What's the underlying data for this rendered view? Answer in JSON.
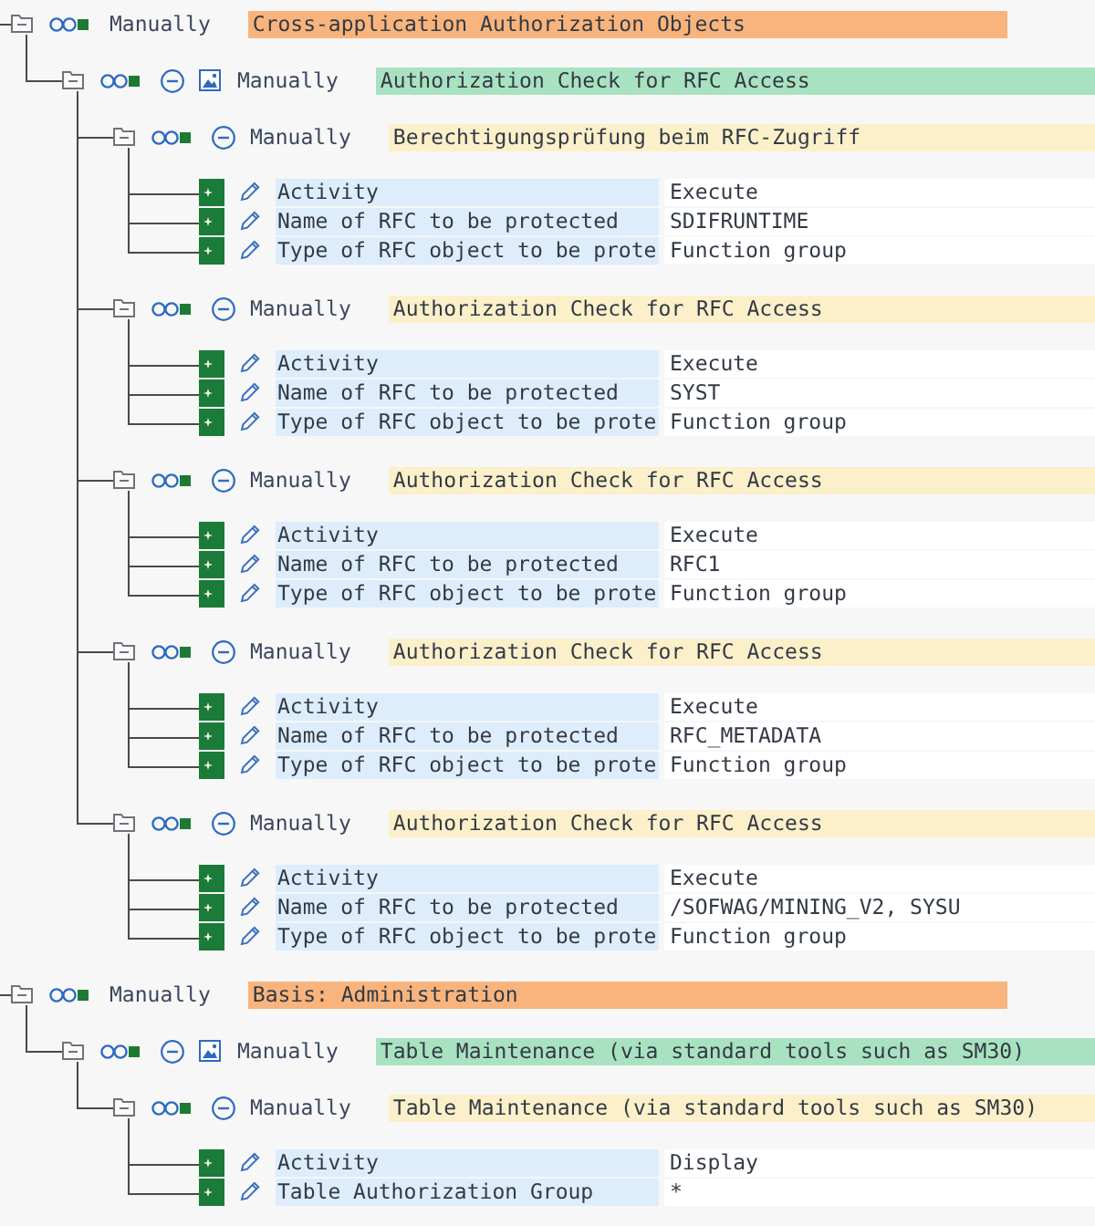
{
  "tree": [
    {
      "kind": "object_class",
      "expanded": true,
      "status": "Manually",
      "text": "Cross-application Authorization Objects",
      "children": [
        {
          "kind": "object",
          "expanded": true,
          "status": "Manually",
          "text": "Authorization Check for RFC Access",
          "children": [
            {
              "kind": "authorization",
              "expanded": true,
              "status": "Manually",
              "text": "Berechtigungsprüfung beim RFC-Zugriff",
              "fields": [
                {
                  "label": "Activity",
                  "value": "Execute"
                },
                {
                  "label": "Name of RFC to be protected",
                  "value": "SDIFRUNTIME"
                },
                {
                  "label": "Type of RFC object to be prote",
                  "value": "Function group"
                }
              ]
            },
            {
              "kind": "authorization",
              "expanded": true,
              "status": "Manually",
              "text": "Authorization Check for RFC Access",
              "fields": [
                {
                  "label": "Activity",
                  "value": "Execute"
                },
                {
                  "label": "Name of RFC to be protected",
                  "value": "SYST"
                },
                {
                  "label": "Type of RFC object to be prote",
                  "value": "Function group"
                }
              ]
            },
            {
              "kind": "authorization",
              "expanded": true,
              "status": "Manually",
              "text": "Authorization Check for RFC Access",
              "fields": [
                {
                  "label": "Activity",
                  "value": "Execute"
                },
                {
                  "label": "Name of RFC to be protected",
                  "value": "RFC1"
                },
                {
                  "label": "Type of RFC object to be prote",
                  "value": "Function group"
                }
              ]
            },
            {
              "kind": "authorization",
              "expanded": true,
              "status": "Manually",
              "text": "Authorization Check for RFC Access",
              "fields": [
                {
                  "label": "Activity",
                  "value": "Execute"
                },
                {
                  "label": "Name of RFC to be protected",
                  "value": "RFC_METADATA"
                },
                {
                  "label": "Type of RFC object to be prote",
                  "value": "Function group"
                }
              ]
            },
            {
              "kind": "authorization",
              "expanded": true,
              "status": "Manually",
              "text": "Authorization Check for RFC Access",
              "fields": [
                {
                  "label": "Activity",
                  "value": "Execute"
                },
                {
                  "label": "Name of RFC to be protected",
                  "value": "/SOFWAG/MINING_V2, SYSU"
                },
                {
                  "label": "Type of RFC object to be prote",
                  "value": "Function group"
                }
              ]
            }
          ]
        }
      ]
    },
    {
      "kind": "object_class",
      "expanded": true,
      "status": "Manually",
      "text": "Basis: Administration",
      "children": [
        {
          "kind": "object",
          "expanded": true,
          "status": "Manually",
          "text": "Table Maintenance (via standard tools such as SM30)",
          "children": [
            {
              "kind": "authorization",
              "expanded": true,
              "status": "Manually",
              "text": "Table Maintenance (via standard tools such as SM30)",
              "fields": [
                {
                  "label": "Activity",
                  "value": "Display"
                },
                {
                  "label": "Table Authorization Group",
                  "value": "*"
                }
              ]
            }
          ]
        }
      ]
    }
  ]
}
